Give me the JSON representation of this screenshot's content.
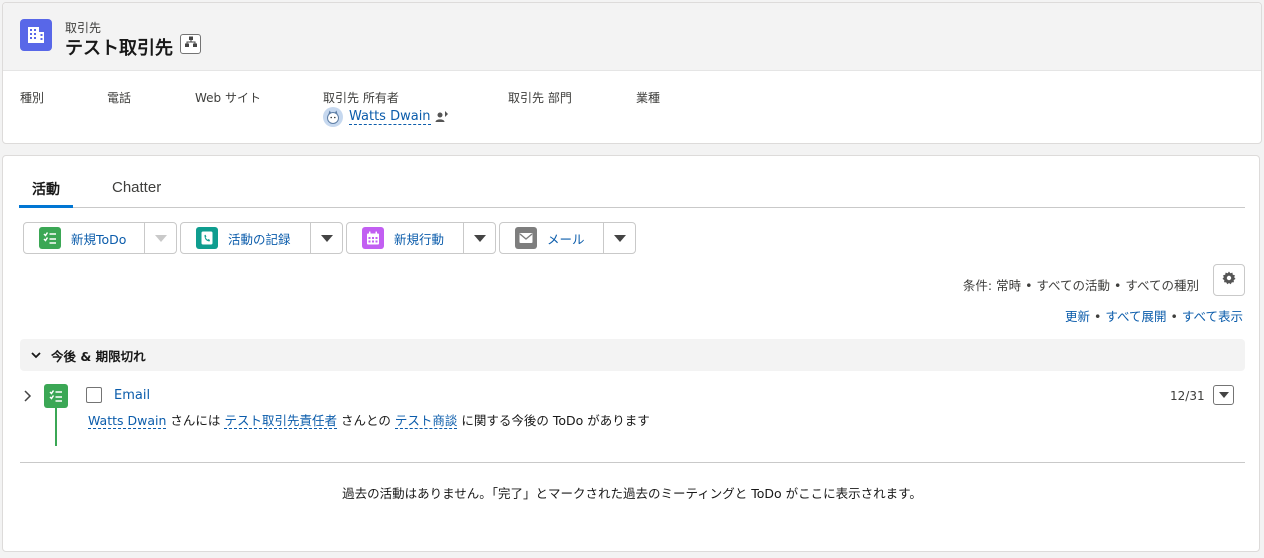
{
  "header": {
    "object_label": "取引先",
    "record_title": "テスト取引先",
    "fields": {
      "type_label": "種別",
      "phone_label": "電話",
      "website_label": "Web サイト",
      "owner_label": "取引先 所有者",
      "department_label": "取引先 部門",
      "industry_label": "業種"
    },
    "owner_name": "Watts Dwain"
  },
  "tabs": [
    {
      "label": "活動",
      "active": true
    },
    {
      "label": "Chatter",
      "active": false
    }
  ],
  "actions": {
    "new_todo": "新規ToDo",
    "log_call": "活動の記録",
    "new_event": "新規行動",
    "email": "メール"
  },
  "filter": {
    "text": "条件: 常時 • すべての活動 • すべての種別",
    "refresh": "更新",
    "expand_all": "すべて展開",
    "view_all": "すべて表示",
    "separator": "•"
  },
  "upcoming": {
    "section_label": "今後 & 期限切れ",
    "item": {
      "subject": "Email",
      "date": "12/31",
      "desc_user": "Watts Dwain",
      "desc_t1": "さんには",
      "desc_contact": "テスト取引先責任者",
      "desc_t2": "さんとの",
      "desc_opportunity": "テスト商談",
      "desc_t3": "に関する今後の ToDo があります"
    }
  },
  "past_message": "過去の活動はありません。「完了」とマークされた過去のミーティングと ToDo がここに表示されます。",
  "colors": {
    "account_icon": "#5867e8",
    "todo_green": "#3ba755",
    "call_teal": "#0f9d8f",
    "event_purple": "#c25ff2",
    "email_gray": "#7e7e7e",
    "link_blue": "#0b5cab",
    "tab_active": "#0176d3"
  }
}
